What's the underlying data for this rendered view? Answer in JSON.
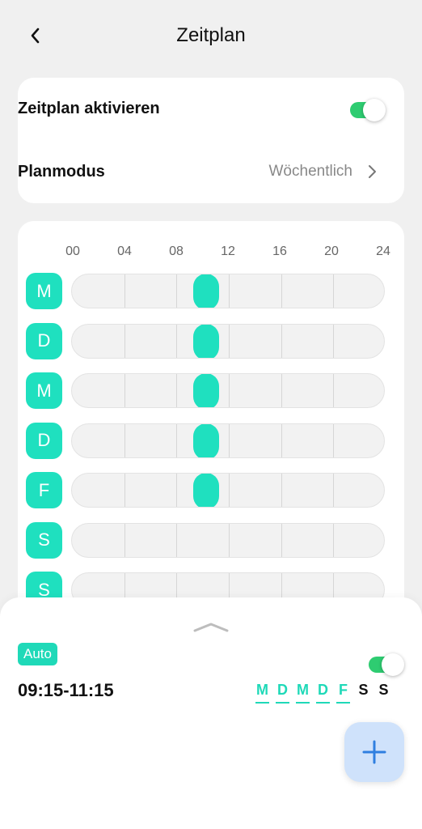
{
  "header": {
    "title": "Zeitplan",
    "back_icon": "chevron-left-icon"
  },
  "settings": {
    "enable_label": "Zeitplan aktivieren",
    "enable_on": true,
    "mode_label": "Planmodus",
    "mode_value": "Wöchentlich",
    "mode_icon": "chevron-right-icon"
  },
  "grid": {
    "hours": [
      "00",
      "04",
      "08",
      "12",
      "16",
      "20",
      "24"
    ],
    "days": [
      {
        "label": "M",
        "slot": [
          9.25,
          11.25
        ]
      },
      {
        "label": "D",
        "slot": [
          9.25,
          11.25
        ]
      },
      {
        "label": "M",
        "slot": [
          9.25,
          11.25
        ]
      },
      {
        "label": "D",
        "slot": [
          9.25,
          11.25
        ]
      },
      {
        "label": "F",
        "slot": [
          9.25,
          11.25
        ]
      },
      {
        "label": "S",
        "slot": null
      },
      {
        "label": "S",
        "slot": null
      }
    ]
  },
  "entry": {
    "mode_badge": "Auto",
    "time_range": "09:15-11:15",
    "enabled": true,
    "days": [
      {
        "label": "M",
        "active": true
      },
      {
        "label": "D",
        "active": true
      },
      {
        "label": "M",
        "active": true
      },
      {
        "label": "D",
        "active": true
      },
      {
        "label": "F",
        "active": true
      },
      {
        "label": "S",
        "active": false
      },
      {
        "label": "S",
        "active": false
      }
    ]
  },
  "actions": {
    "add_icon": "plus-icon",
    "grabber_icon": "chevron-up-icon"
  },
  "colors": {
    "accent": "#1fe0bf",
    "toggle_on": "#2ecc71",
    "fab_bg": "#cfe2fb",
    "fab_icon": "#2f7fe0"
  }
}
